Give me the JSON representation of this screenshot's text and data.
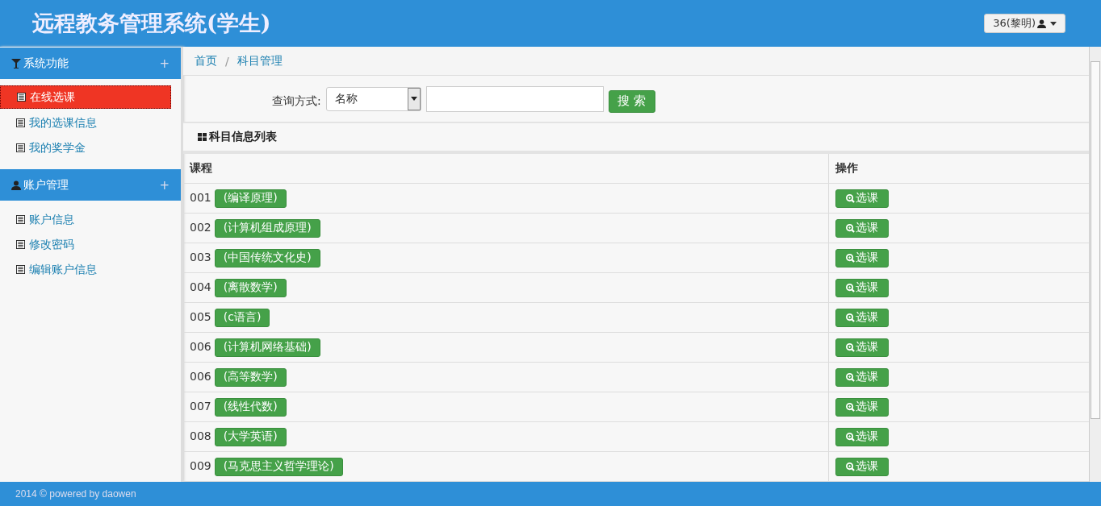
{
  "header": {
    "title": "远程教务管理系统(学生)",
    "user_menu": "36(黎明)"
  },
  "sidebar": {
    "sections": [
      {
        "title": "系统功能",
        "kind": "functions",
        "toggle": "+",
        "items": [
          {
            "label": "在线选课",
            "selected": true
          },
          {
            "label": "我的选课信息",
            "selected": false
          },
          {
            "label": "我的奖学金",
            "selected": false
          }
        ]
      },
      {
        "title": "账户管理",
        "kind": "account",
        "toggle": "+",
        "items": [
          {
            "label": "账户信息",
            "selected": false
          },
          {
            "label": "修改密码",
            "selected": false
          },
          {
            "label": "编辑账户信息",
            "selected": false
          }
        ]
      }
    ]
  },
  "breadcrumb": {
    "separator": "/",
    "items": [
      "首页",
      "科目管理"
    ]
  },
  "search": {
    "label": "查询方式:",
    "select_value": "名称",
    "button": "搜 索"
  },
  "panel": {
    "title": "科目信息列表"
  },
  "table": {
    "columns": [
      "课程",
      "操作"
    ],
    "rows": [
      {
        "code": "001",
        "name": "(编译原理)",
        "action": "选课"
      },
      {
        "code": "002",
        "name": "(计算机组成原理)",
        "action": "选课"
      },
      {
        "code": "003",
        "name": "(中国传统文化史)",
        "action": "选课"
      },
      {
        "code": "004",
        "name": "(离散数学)",
        "action": "选课"
      },
      {
        "code": "005",
        "name": "(c语言)",
        "action": "选课"
      },
      {
        "code": "006",
        "name": "(计算机网络基础)",
        "action": "选课"
      },
      {
        "code": "006",
        "name": "(高等数学)",
        "action": "选课"
      },
      {
        "code": "007",
        "name": "(线性代数)",
        "action": "选课"
      },
      {
        "code": "008",
        "name": "(大学英语)",
        "action": "选课"
      },
      {
        "code": "009",
        "name": "(马克思主义哲学理论)",
        "action": "选课"
      }
    ]
  },
  "footer": "2014 © powered by daowen"
}
